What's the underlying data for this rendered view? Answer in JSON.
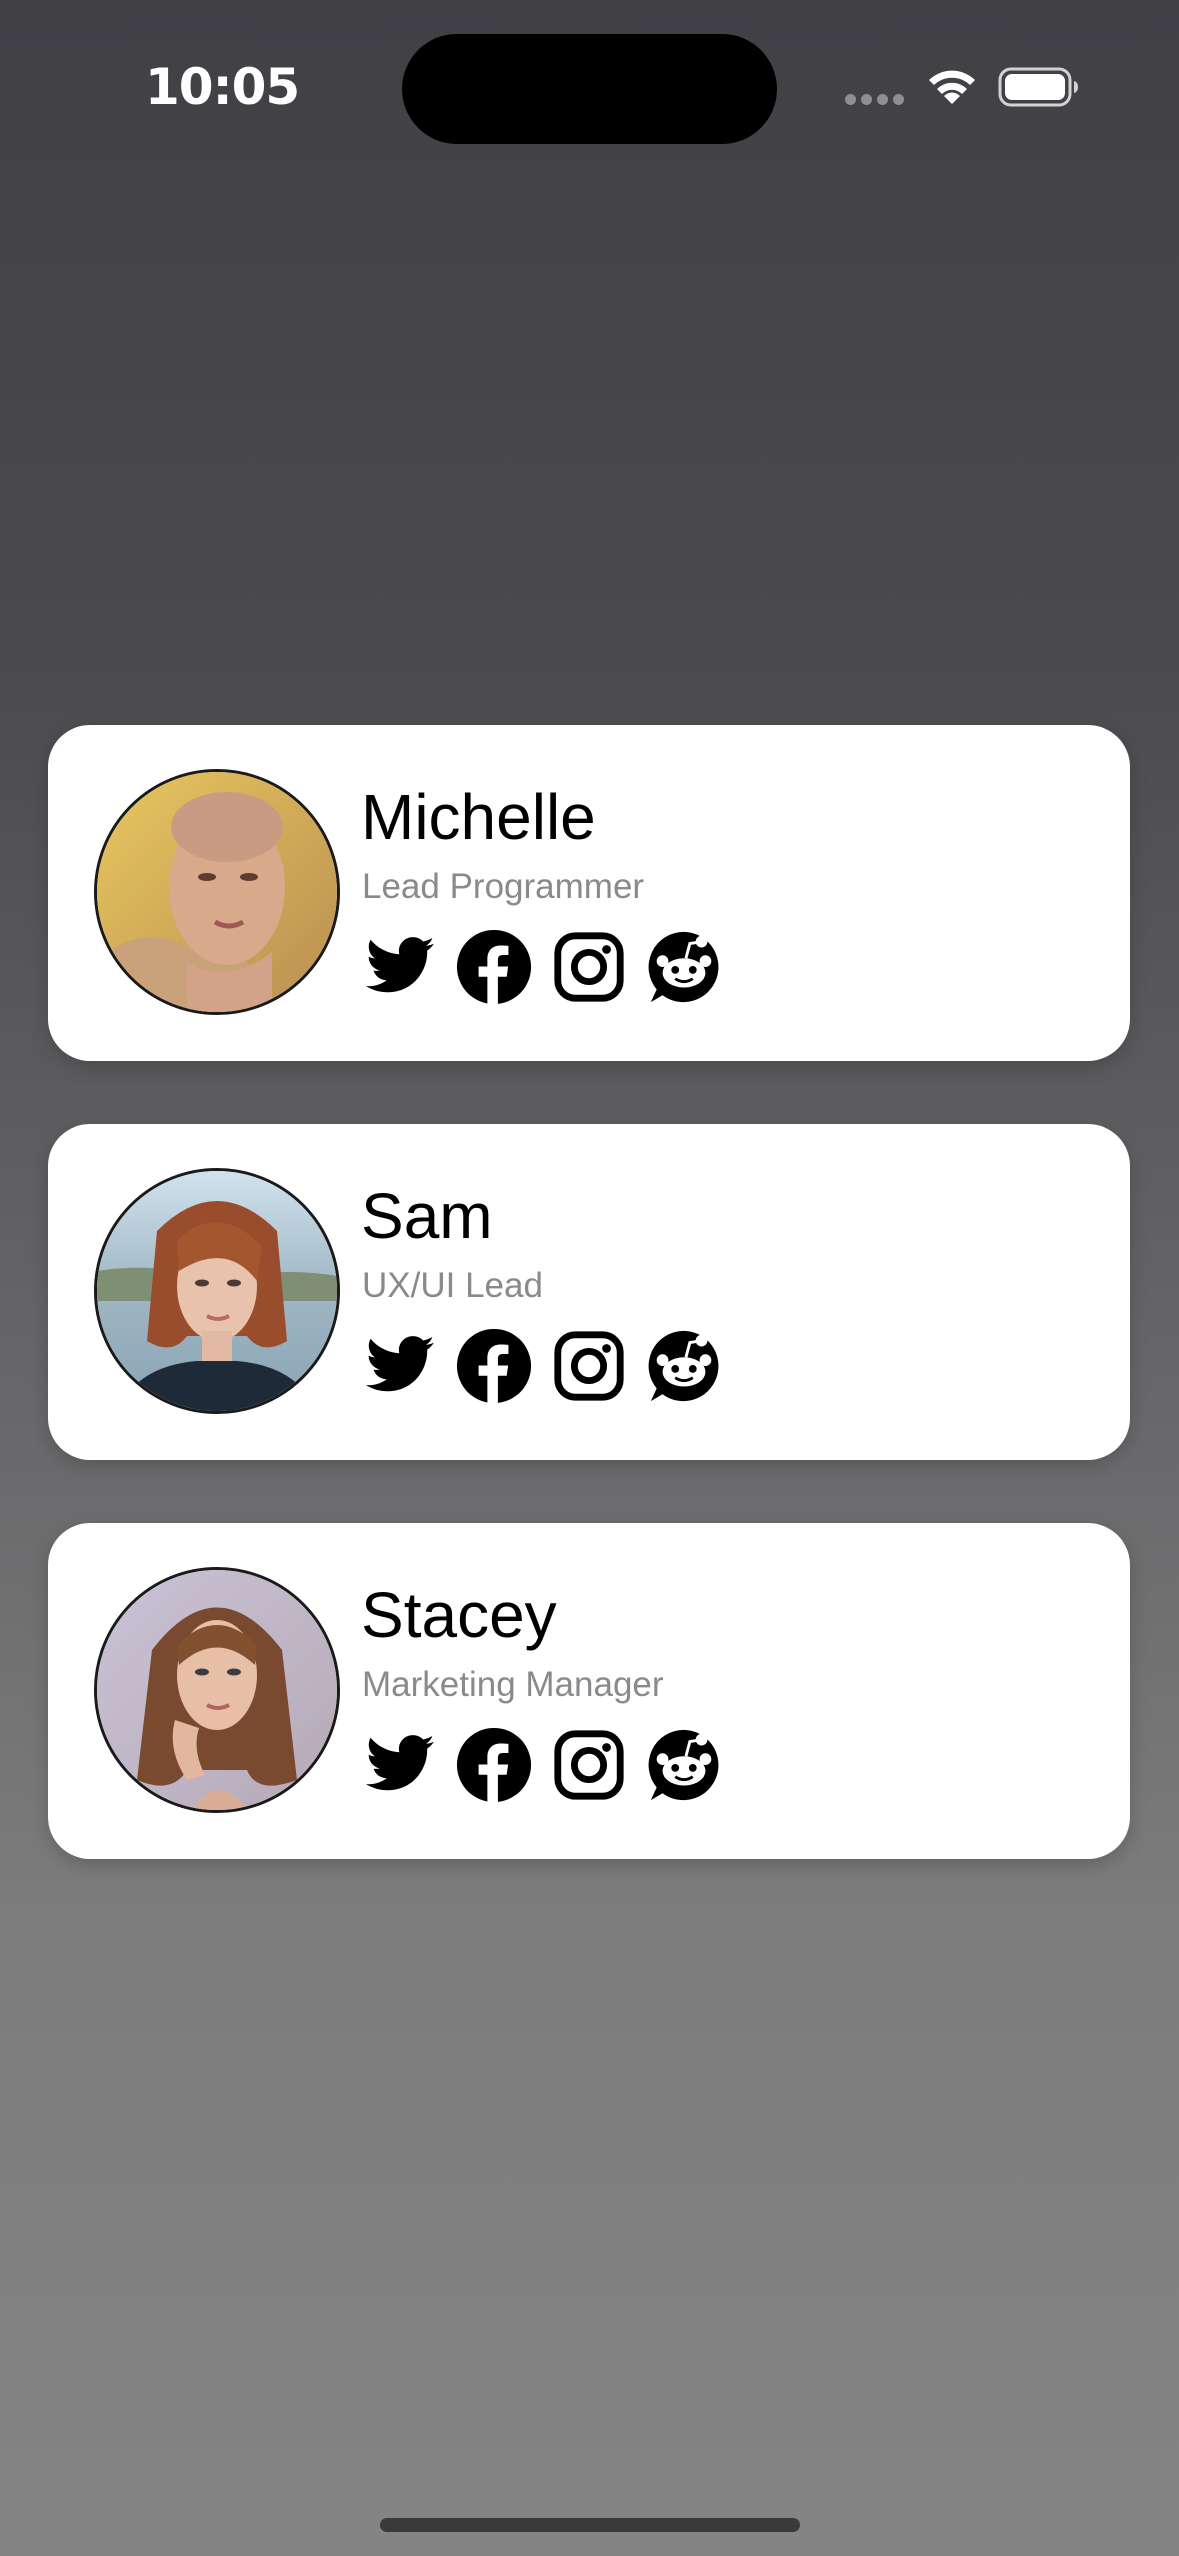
{
  "status_bar": {
    "time": "10:05",
    "signal_icon": "cellular-signal-icon",
    "wifi_icon": "wifi-icon",
    "battery_icon": "battery-icon"
  },
  "profiles": [
    {
      "name": "Michelle",
      "role": "Lead Programmer",
      "photo": "avatar-photo-woman-shaved-head",
      "socials": [
        "twitter-icon",
        "facebook-icon",
        "instagram-icon",
        "reddit-icon"
      ]
    },
    {
      "name": "Sam",
      "role": "UX/UI Lead",
      "photo": "avatar-photo-woman-auburn-bob",
      "socials": [
        "twitter-icon",
        "facebook-icon",
        "instagram-icon",
        "reddit-icon"
      ]
    },
    {
      "name": "Stacey",
      "role": "Marketing Manager",
      "photo": "avatar-photo-woman-long-brown-hair",
      "socials": [
        "twitter-icon",
        "facebook-icon",
        "instagram-icon",
        "reddit-icon"
      ]
    }
  ],
  "colors": {
    "card_background": "#ffffff",
    "name_text": "#000000",
    "role_text": "#8a8a8e",
    "icon": "#000000"
  }
}
